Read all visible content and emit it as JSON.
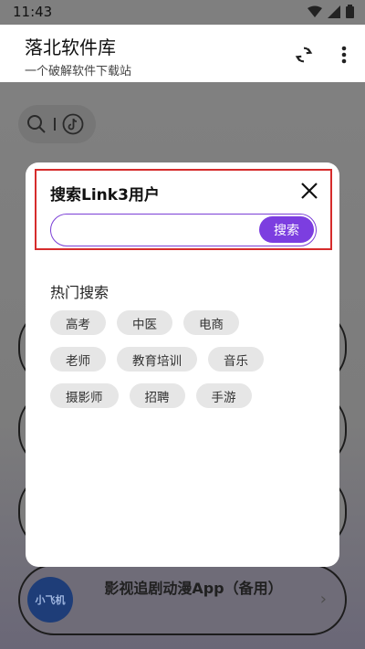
{
  "status_bar": {
    "time": "11:43"
  },
  "header": {
    "title": "落北软件库",
    "subtitle": "一个破解软件下载站"
  },
  "background": {
    "cards": [
      {
        "logo_text": "小飞机",
        "title": "影视追剧动漫App（备用）"
      }
    ]
  },
  "modal": {
    "title": "搜索Link3用户",
    "search": {
      "value": "",
      "placeholder": "",
      "button_label": "搜索"
    },
    "hot_title": "热门搜索",
    "tag_rows": [
      [
        "高考",
        "中医",
        "电商"
      ],
      [
        "老师",
        "教育培训",
        "音乐"
      ],
      [
        "摄影师",
        "招聘",
        "手游"
      ]
    ]
  },
  "colors": {
    "accent": "#7c3ee0",
    "highlight_border": "#d62c2c",
    "overlay": "#7d7d7d"
  }
}
